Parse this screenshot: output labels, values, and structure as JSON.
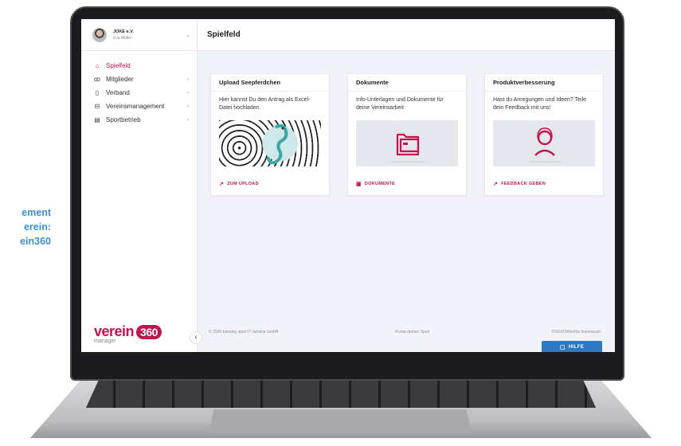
{
  "promo": [
    "ement",
    "erein:",
    "ein360"
  ],
  "account": {
    "club": "JOKE e.V.",
    "user": "Eva Müller"
  },
  "sidebar": {
    "items": [
      {
        "label": "Spielfeld",
        "icon": "home-icon",
        "active": true
      },
      {
        "label": "Mitglieder",
        "icon": "members-icon"
      },
      {
        "label": "Verband",
        "icon": "federation-icon"
      },
      {
        "label": "Vereinsmanagement",
        "icon": "briefcase-icon"
      },
      {
        "label": "Sportbetrieb",
        "icon": "clipboard-icon"
      }
    ],
    "logo_main": "verein",
    "logo_badge": "360",
    "logo_sub": "manager"
  },
  "header": {
    "title": "Spielfeld"
  },
  "cards": [
    {
      "title": "Upload Seepferdchen",
      "desc": "Hier kannst Du den Antrag als Excel-Datei hochladen",
      "link": "ZUM UPLOAD",
      "image": "seahorse-illustration"
    },
    {
      "title": "Dokumente",
      "desc": "Info-Unterlagen und Dokumente für deine Vereinsarbeit",
      "link": "DOKUMENTE",
      "image": "folder-icon"
    },
    {
      "title": "Produktverbesserung",
      "desc": "Hast du Anregungen und Ideen? Teile dein Feedback mit uns!",
      "link": "FEEDBACK GEBEN",
      "image": "support-icon"
    }
  ],
  "footer": {
    "copyright": "© 2020 tuesday sport IT-Service GmbH",
    "motto": "#Lebe deinen Sport",
    "links": "DSGVO/Rechts Impressum"
  },
  "help_label": "HILFE",
  "colors": {
    "accent": "#c0144e",
    "help": "#2f78c4",
    "promo": "#3d8fd6"
  }
}
